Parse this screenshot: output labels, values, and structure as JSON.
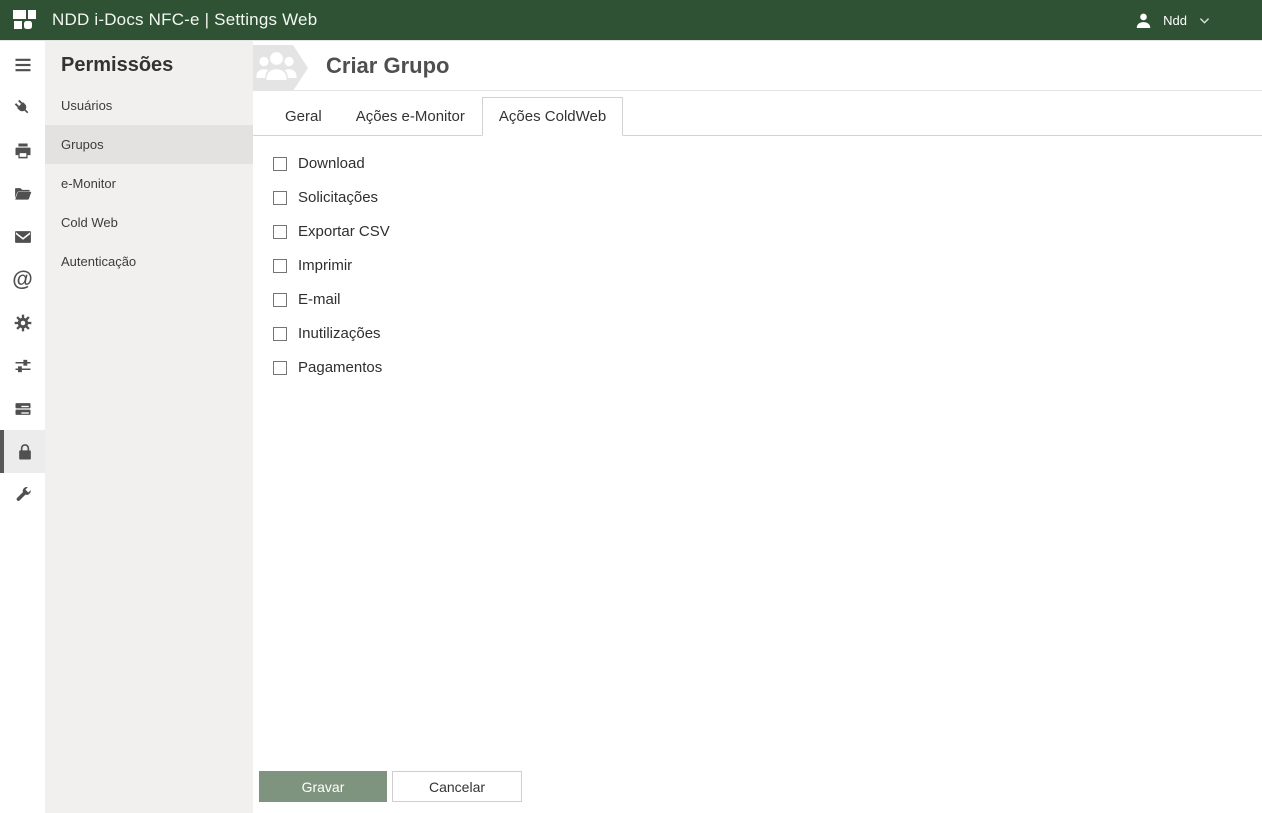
{
  "colors": {
    "header_green": "#2e5233",
    "save_button_green": "#7f947e",
    "sidebar_panel_gray": "#f1f0ef",
    "selected_item_gray": "#e3e2e1",
    "active_rail_gray": "#ececec"
  },
  "topbar": {
    "title": "NDD i-Docs NFC-e | Settings Web",
    "user": {
      "name": "Ndd"
    }
  },
  "iconbar": {
    "items": [
      {
        "name": "menu"
      },
      {
        "name": "plug"
      },
      {
        "name": "printer"
      },
      {
        "name": "folder"
      },
      {
        "name": "mail"
      },
      {
        "name": "at"
      },
      {
        "name": "gear"
      },
      {
        "name": "sliders"
      },
      {
        "name": "servers"
      },
      {
        "name": "lock",
        "active": true
      },
      {
        "name": "wrench"
      }
    ]
  },
  "sidebar": {
    "title": "Permissões",
    "items": [
      {
        "label": "Usuários",
        "selected": false
      },
      {
        "label": "Grupos",
        "selected": true
      },
      {
        "label": "e-Monitor",
        "selected": false
      },
      {
        "label": "Cold Web",
        "selected": false
      },
      {
        "label": "Autenticação",
        "selected": false
      }
    ]
  },
  "page": {
    "title": "Criar Grupo"
  },
  "tabs": [
    {
      "label": "Geral",
      "active": false
    },
    {
      "label": "Ações e-Monitor",
      "active": false
    },
    {
      "label": "Ações ColdWeb",
      "active": true
    }
  ],
  "checkboxes": [
    {
      "label": "Download",
      "checked": false
    },
    {
      "label": "Solicitações",
      "checked": false
    },
    {
      "label": "Exportar CSV",
      "checked": false
    },
    {
      "label": "Imprimir",
      "checked": false
    },
    {
      "label": "E-mail",
      "checked": false
    },
    {
      "label": "Inutilizações",
      "checked": false
    },
    {
      "label": "Pagamentos",
      "checked": false
    }
  ],
  "footer": {
    "save_label": "Gravar",
    "cancel_label": "Cancelar"
  }
}
